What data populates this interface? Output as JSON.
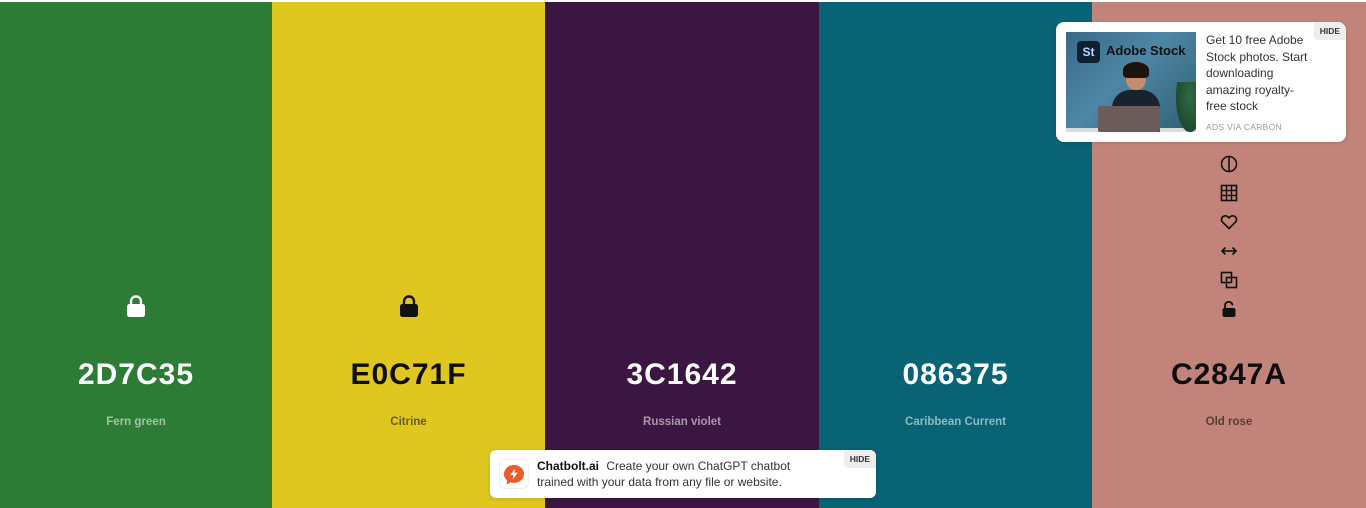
{
  "colors": [
    {
      "hex": "2D7C35",
      "name": "Fern green",
      "bg": "#2D7C35",
      "tone": "light",
      "locked": true
    },
    {
      "hex": "E0C71F",
      "name": "Citrine",
      "bg": "#E0C71F",
      "tone": "dark",
      "locked": true
    },
    {
      "hex": "3C1642",
      "name": "Russian violet",
      "bg": "#3C1642",
      "tone": "light",
      "locked": false
    },
    {
      "hex": "086375",
      "name": "Caribbean Current",
      "bg": "#086375",
      "tone": "light",
      "locked": false
    },
    {
      "hex": "C2847A",
      "name": "Old rose",
      "bg": "#C2847A",
      "tone": "dark",
      "locked": false
    }
  ],
  "swatch_tools": {
    "icons": [
      "contrast-icon",
      "shades-grid-icon",
      "heart-icon",
      "drag-arrows-icon",
      "copy-icon",
      "unlock-icon"
    ]
  },
  "ads": {
    "carbon": {
      "logo_text": "St",
      "brand": "Adobe Stock",
      "text": "Get 10 free Adobe Stock photos. Start downloading amazing royalty-free stock",
      "via": "ADS VIA CARBON",
      "hide_label": "HIDE"
    },
    "chatbolt": {
      "brand": "Chatbolt.ai",
      "text": "Create your own ChatGPT chatbot trained with your data from any file or website.",
      "hide_label": "HIDE",
      "logo_color": "#F05A28"
    }
  }
}
